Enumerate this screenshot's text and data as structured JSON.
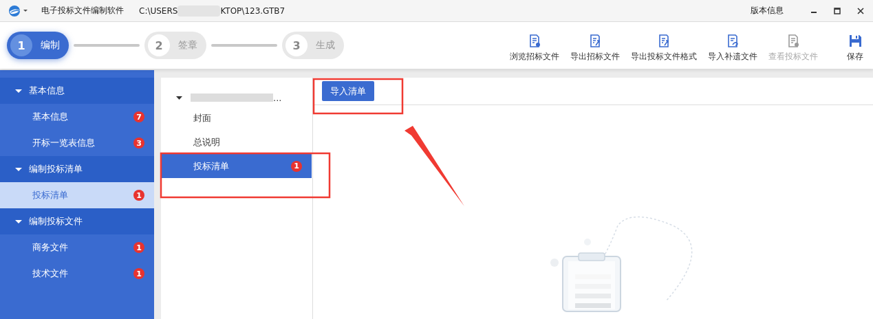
{
  "title_bar": {
    "app_name": "电子投标文件编制软件",
    "path_start": "C:\\USERS",
    "path_end": "KTOP\\123.GTB7",
    "version_link": "版本信息"
  },
  "steps": [
    {
      "number": "1",
      "label": "编制",
      "selected": true
    },
    {
      "number": "2",
      "label": "签章",
      "selected": false
    },
    {
      "number": "3",
      "label": "生成",
      "selected": false
    }
  ],
  "toolbar": [
    {
      "kind": "file",
      "label": "浏览招标文件",
      "disabled": false
    },
    {
      "kind": "export",
      "label": "导出招标文件",
      "disabled": false
    },
    {
      "kind": "export",
      "label": "导出投标文件格式",
      "disabled": false
    },
    {
      "kind": "import",
      "label": "导入补遗文件",
      "disabled": false
    },
    {
      "kind": "file",
      "label": "查看投标文件",
      "disabled": true
    },
    {
      "kind": "save",
      "label": "保存",
      "disabled": false
    }
  ],
  "sidebar": [
    {
      "label": "基本信息",
      "expanded": true,
      "items": [
        {
          "label": "基本信息",
          "badge": "7",
          "selected": false
        },
        {
          "label": "开标一览表信息",
          "badge": "3",
          "selected": false
        }
      ]
    },
    {
      "label": "编制投标清单",
      "expanded": true,
      "items": [
        {
          "label": "投标清单",
          "badge": "1",
          "selected": true
        }
      ]
    },
    {
      "label": "编制投标文件",
      "expanded": true,
      "items": [
        {
          "label": "商务文件",
          "badge": "1",
          "selected": false
        },
        {
          "label": "技术文件",
          "badge": "1",
          "selected": false
        }
      ]
    }
  ],
  "tree": {
    "root_text": "...",
    "expanded": true,
    "children": [
      {
        "label": "封面",
        "selected": false
      },
      {
        "label": "总说明",
        "selected": false
      },
      {
        "label": "投标清单",
        "badge": "1",
        "selected": true
      }
    ]
  },
  "import_button": "导入清单"
}
